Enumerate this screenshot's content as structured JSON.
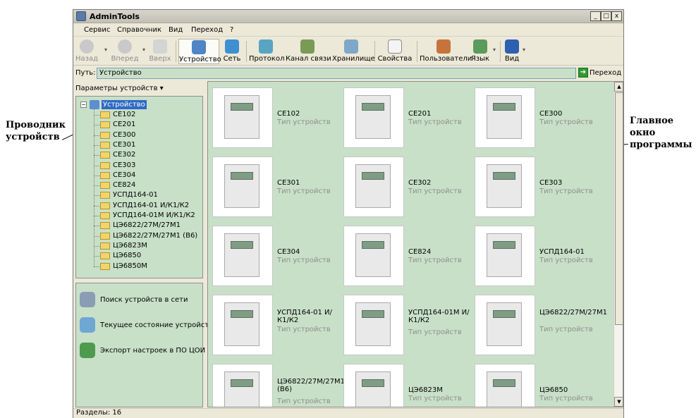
{
  "annotations": {
    "left_line1": "Проводник",
    "left_line2": "устройств",
    "right_line1": "Главное",
    "right_line2": "окно",
    "right_line3": "программы"
  },
  "window": {
    "title": "AdminTools",
    "minimize": "_",
    "maximize": "□",
    "close": "x"
  },
  "menu": [
    "Сервис",
    "Справочник",
    "Вид",
    "Переход",
    "?"
  ],
  "toolbar": {
    "back": "Назад",
    "forward": "Вперед",
    "up": "Вверх",
    "device": "Устройство",
    "network": "Сеть",
    "protocol": "Протокол",
    "channel": "Канал связи",
    "storage": "Хранилище",
    "properties": "Свойства",
    "users": "Пользователи",
    "language": "Язык",
    "view": "Вид"
  },
  "path": {
    "label": "Путь:",
    "value": "Устройство",
    "go": "Переход"
  },
  "left_panel": {
    "header": "Параметры устройств ▾",
    "tree_root": "Устройство",
    "tree_items": [
      "CE102",
      "CE201",
      "CE300",
      "CE301",
      "CE302",
      "CE303",
      "CE304",
      "CE824",
      "УСПД164-01",
      "УСПД164-01 И/К1/К2",
      "УСПД164-01М И/К1/К2",
      "ЦЭ6822/27М/27М1",
      "ЦЭ6822/27М/27М1 (В6)",
      "ЦЭ6823М",
      "ЦЭ6850",
      "ЦЭ6850М"
    ],
    "tasks": [
      "Поиск устройств в сети",
      "Текущее состояние устройств",
      "Экспорт настроек в ПО ЦОИ"
    ]
  },
  "main": {
    "type_label": "Тип устройств",
    "cards": [
      {
        "name": "CE102"
      },
      {
        "name": "CE201"
      },
      {
        "name": "CE300"
      },
      {
        "name": "CE301"
      },
      {
        "name": "CE302"
      },
      {
        "name": "CE303"
      },
      {
        "name": "CE304"
      },
      {
        "name": "CE824"
      },
      {
        "name": "УСПД164-01"
      },
      {
        "name": "УСПД164-01 И/К1/К2"
      },
      {
        "name": "УСПД164-01М И/К1/К2"
      },
      {
        "name": "ЦЭ6822/27М/27М1"
      },
      {
        "name": "ЦЭ6822/27М/27М1 (В6)"
      },
      {
        "name": "ЦЭ6823М"
      },
      {
        "name": "ЦЭ6850"
      }
    ]
  },
  "status": {
    "text": "Разделы: 16"
  },
  "colors": {
    "pane_bg": "#c8e0c8",
    "window_bg": "#ece9d8",
    "selection": "#316ac5",
    "secondary_text": "#8e8e8e"
  }
}
